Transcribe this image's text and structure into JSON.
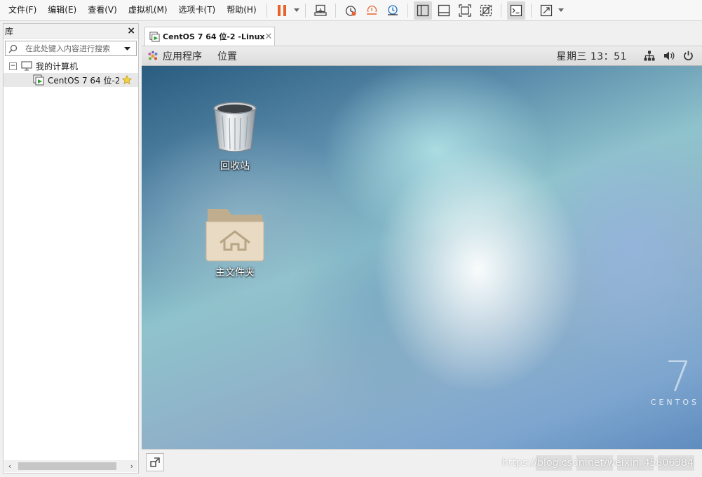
{
  "menu": [
    {
      "label": "文件(F)",
      "name": "menu-file"
    },
    {
      "label": "编辑(E)",
      "name": "menu-edit"
    },
    {
      "label": "查看(V)",
      "name": "menu-view"
    },
    {
      "label": "虚拟机(M)",
      "name": "menu-vm"
    },
    {
      "label": "选项卡(T)",
      "name": "menu-tabs"
    },
    {
      "label": "帮助(H)",
      "name": "menu-help"
    }
  ],
  "toolbar": {
    "icons": [
      "pause-icon",
      "send-ctrl-alt-del-icon",
      "snapshot-icon",
      "revert-snapshot-icon",
      "snapshot-manager-icon",
      "sidebar-toggle-icon",
      "thumbnail-bar-icon",
      "fullscreen-icon",
      "unity-icon",
      "console-view-icon",
      "stretch-icon"
    ],
    "colors": {
      "pause": "#e8622b",
      "accent_blue": "#1e73be",
      "accent_orange": "#e8622b"
    }
  },
  "library": {
    "title": "库",
    "search_placeholder": "在此处键入内容进行搜索",
    "tree": {
      "root_label": "我的计算机",
      "vm_label": "CentOS 7  64 位-2"
    }
  },
  "vm_tab": {
    "title": "CentOS 7  64 位-2 -Linux"
  },
  "guest": {
    "apps_label": "应用程序",
    "places_label": "位置",
    "clock": "星期三 13：51"
  },
  "desktop": {
    "icons": [
      {
        "label": "回收站",
        "icon": "trash-icon"
      },
      {
        "label": "主文件夹",
        "icon": "home-folder-icon"
      }
    ],
    "brand_number": "7",
    "brand_word": "CENTOS"
  },
  "watermark": "https://blog.csdn.net/weixin_45806384"
}
